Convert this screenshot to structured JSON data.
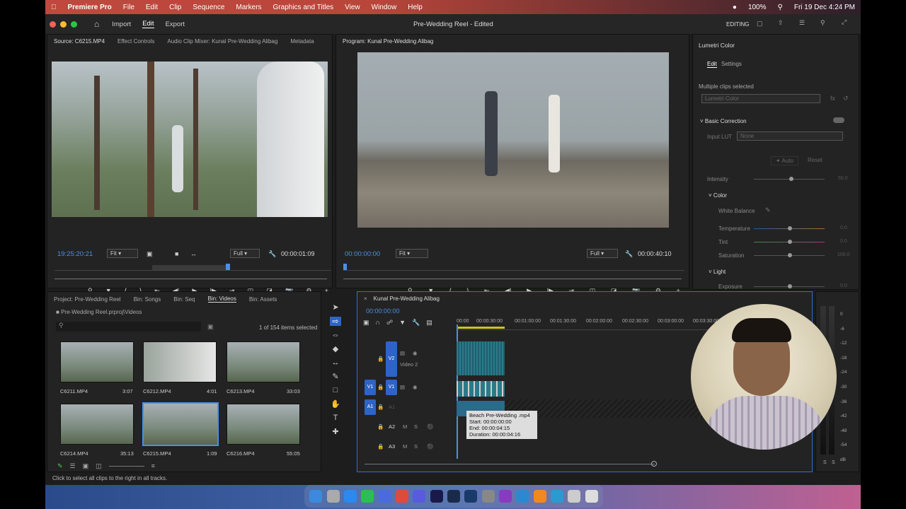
{
  "menubar": {
    "app": "Premiere Pro",
    "items": [
      "File",
      "Edit",
      "Clip",
      "Sequence",
      "Markers",
      "Graphics and Titles",
      "View",
      "Window",
      "Help"
    ],
    "battery": "100%",
    "datetime": "Fri 19 Dec  4:24 PM"
  },
  "titlebar": {
    "tabs": [
      "Import",
      "Edit",
      "Export"
    ],
    "title": "Pre-Wedding Reel - Edited",
    "workspace": "EDITING"
  },
  "source": {
    "tabs": [
      "Source: C6215.MP4",
      "Effect Controls",
      "Audio Clip Mixer: Kunal Pre-Wedding Alibag",
      "Metadata"
    ],
    "timecode": "19:25:20:21",
    "fit": "Fit",
    "quality": "Full",
    "duration": "00:00:01:09"
  },
  "program": {
    "tab": "Program: Kunal Pre-Wedding Alibag",
    "timecode": "00:00:00:00",
    "fit": "Fit",
    "quality": "Full",
    "duration": "00:00:40:10"
  },
  "lumetri": {
    "title": "Lumetri Color",
    "tabs": [
      "Edit",
      "Settings"
    ],
    "selection": "Multiple clips selected",
    "dropdown": "Lumetri Color",
    "basic": "Basic Correction",
    "input_lut_label": "Input LUT",
    "input_lut": "None",
    "auto": "Auto",
    "reset": "Reset",
    "intensity_label": "Intensity",
    "intensity": "50.0",
    "color": "Color",
    "white_balance": "White Balance",
    "temperature_label": "Temperature",
    "temperature": "0.0",
    "tint_label": "Tint",
    "tint": "0.0",
    "saturation_label": "Saturation",
    "saturation": "100.0",
    "light": "Light",
    "exposure_label": "Exposure",
    "exposure": "0.0"
  },
  "project": {
    "tabs": [
      "Project: Pre-Wedding Reel",
      "Bin: Songs",
      "Bin: Seq",
      "Bin: Videos",
      "Bin: Assets"
    ],
    "path": "Pre-Wedding Reel.prproj\\Videos",
    "count": "1 of 154 items selected",
    "clips": [
      {
        "name": "C6211.MP4",
        "dur": "3:07"
      },
      {
        "name": "C6212.MP4",
        "dur": "4:01"
      },
      {
        "name": "C6213.MP4",
        "dur": "33:03"
      },
      {
        "name": "C6214.MP4",
        "dur": "35:13"
      },
      {
        "name": "C6215.MP4",
        "dur": "1:09"
      },
      {
        "name": "C6216.MP4",
        "dur": "55:05"
      }
    ]
  },
  "timeline": {
    "tab": "Kunal Pre-Wedding Alibag",
    "timecode": "00:00:00:00",
    "ruler": [
      "00:00",
      "00:00:30:00",
      "00:01:00:00",
      "00:01:30:00",
      "00:02:00:00",
      "00:02:30:00",
      "00:03:00:00",
      "00:03:30:00"
    ],
    "tracks": {
      "v2": "V2",
      "v2_name": "Video 2",
      "v1": "V1",
      "a1": "A1",
      "a2": "A2",
      "a3": "A3",
      "src_v1": "V1",
      "src_a1": "A1"
    },
    "tooltip": {
      "name": "Beach Pre-Wedding .mp4",
      "start": "Start: 00:00:00:00",
      "end": "End: 00:00:04:15",
      "duration": "Duration: 00:00:04:16"
    }
  },
  "meter": {
    "labels": [
      "0",
      "-6",
      "-12",
      "-18",
      "-24",
      "-30",
      "-36",
      "-42",
      "-48",
      "-54",
      "dB"
    ],
    "solo": [
      "S",
      "S"
    ]
  },
  "status": "Click to select all clips to the right in all tracks."
}
